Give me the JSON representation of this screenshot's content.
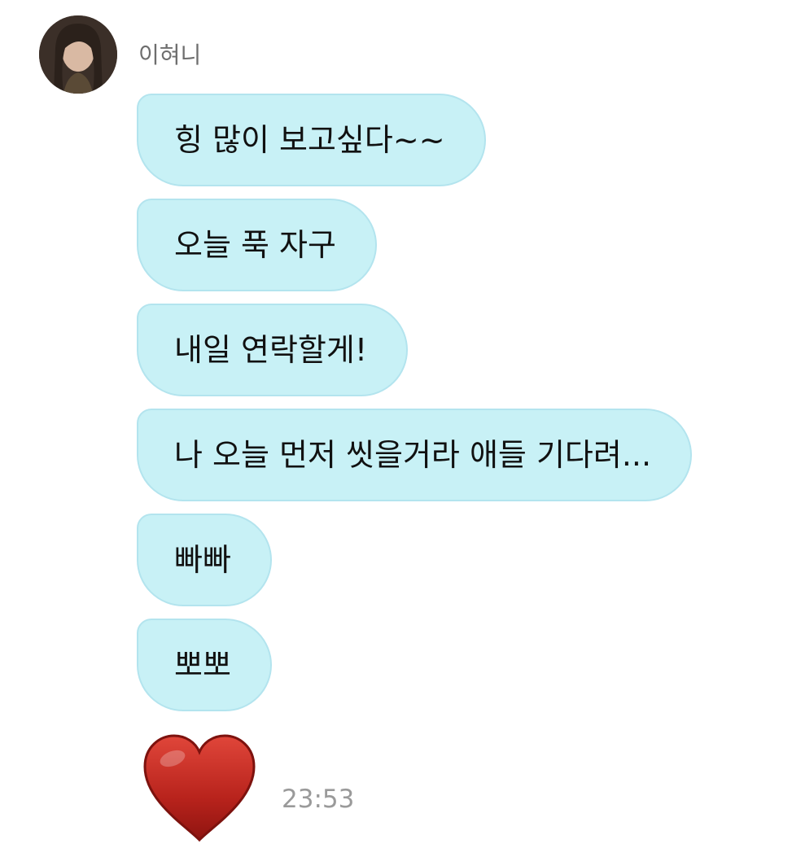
{
  "sender": {
    "name": "이혀니",
    "avatar_icon": "profile-photo"
  },
  "messages": [
    {
      "text": "힝 많이 보고싶다~~"
    },
    {
      "text": "오늘 푹 자구"
    },
    {
      "text": "내일 연락할게!"
    },
    {
      "text": "나 오늘 먼저 씻을거라 애들 기다려..."
    },
    {
      "text": "빠빠"
    },
    {
      "text": "뽀뽀"
    }
  ],
  "last_message": {
    "emoji": "red-heart-icon",
    "time": "23:53"
  },
  "colors": {
    "bubble_background": "#c8f1f6",
    "bubble_border": "#b3e4ee",
    "heart": "#c0392b",
    "timestamp": "#9a9a9a"
  }
}
